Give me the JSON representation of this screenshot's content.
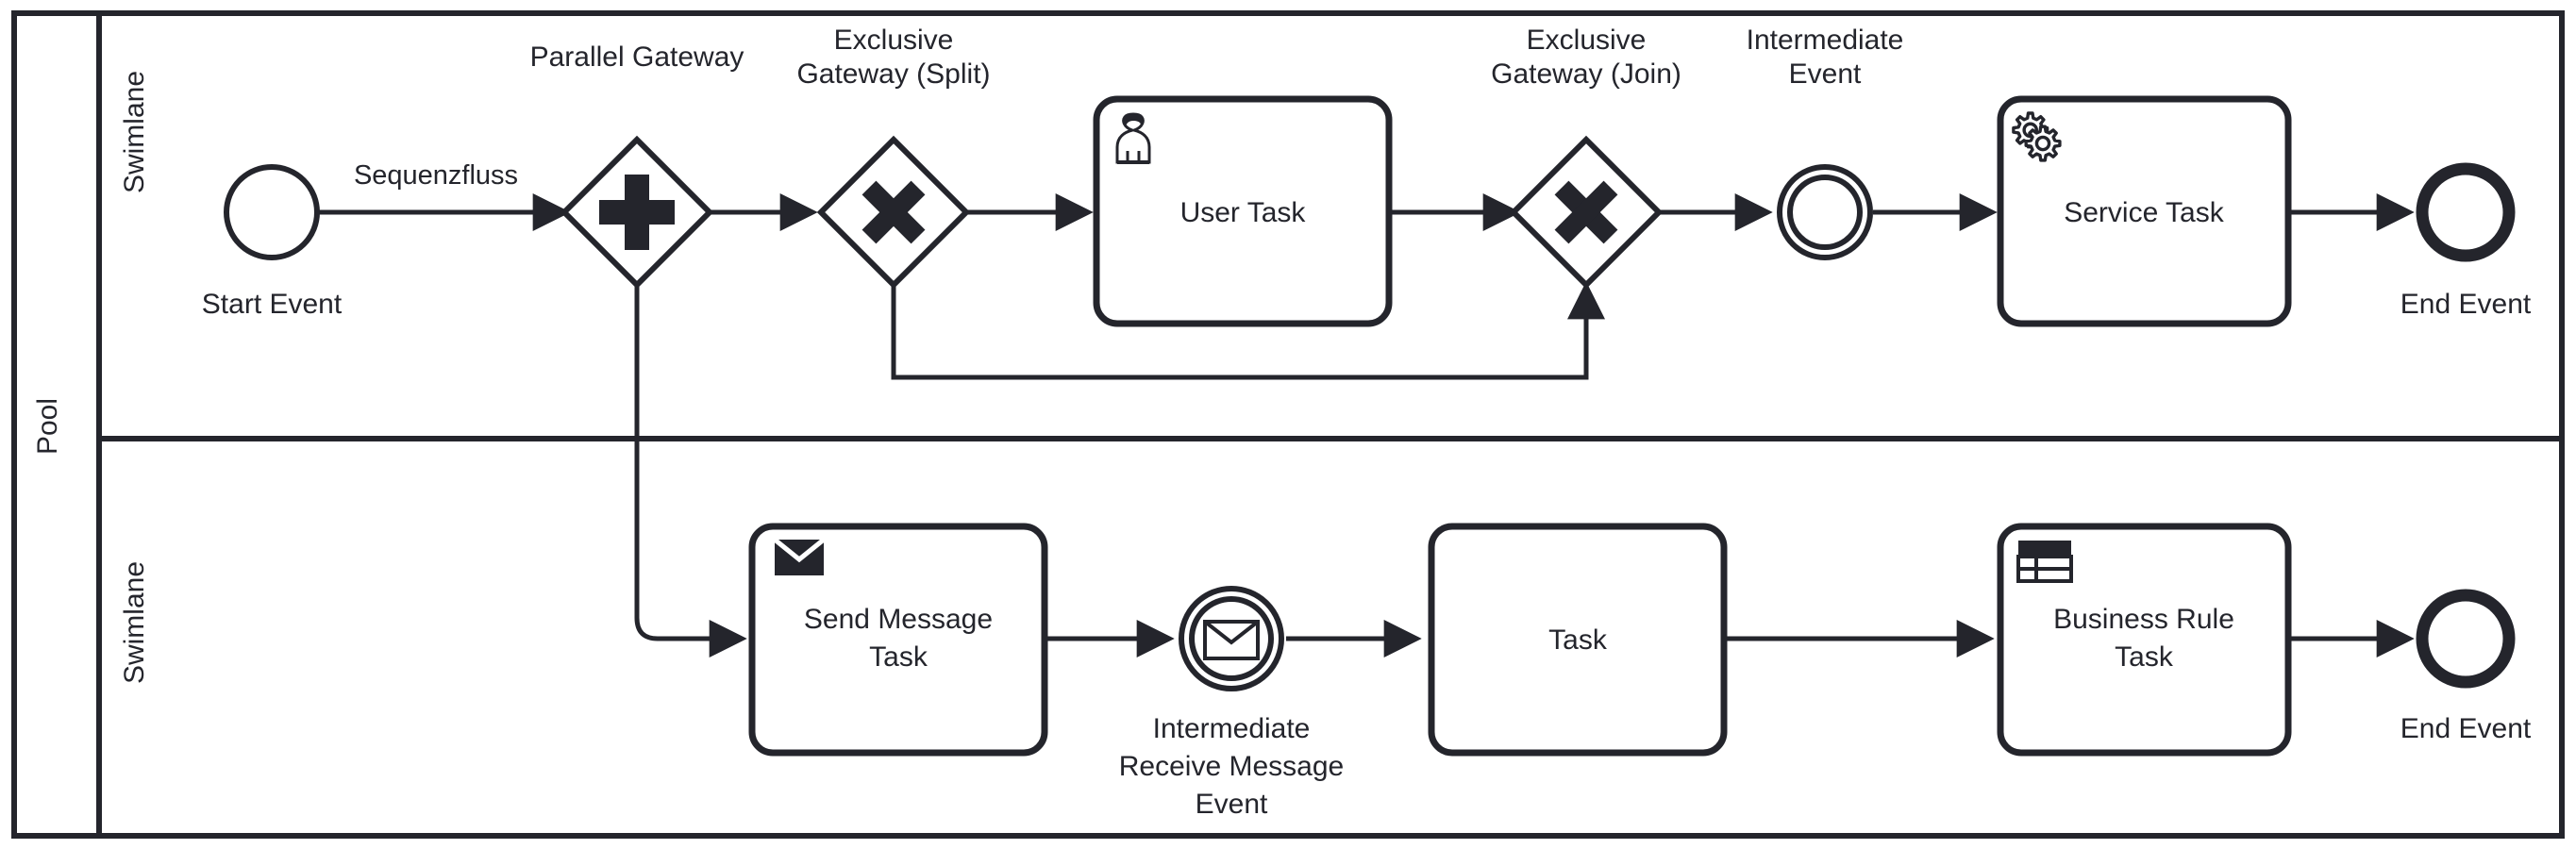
{
  "diagram": {
    "type": "BPMN process diagram",
    "pool": {
      "label": "Pool"
    },
    "lanes": [
      {
        "id": "lane-top",
        "label": "Swimlane"
      },
      {
        "id": "lane-bottom",
        "label": "Swimlane"
      }
    ],
    "colors": {
      "stroke": "#24252c",
      "fill": "#ffffff",
      "background": "#ffffff"
    },
    "flow_labels": [
      {
        "id": "sequence-flow-label",
        "text": "Sequenzfluss"
      }
    ],
    "nodes_top": [
      {
        "id": "start-event",
        "type": "start-event",
        "label": "Start Event",
        "label_position": "below"
      },
      {
        "id": "parallel-gateway",
        "type": "parallel-gateway",
        "label": "Parallel Gateway",
        "label_position": "above",
        "marker": "plus"
      },
      {
        "id": "exclusive-gateway-split",
        "type": "exclusive-gateway",
        "label_line1": "Exclusive",
        "label_line2": "Gateway (Split)",
        "label_position": "above",
        "marker": "x"
      },
      {
        "id": "user-task",
        "type": "task",
        "label": "User Task",
        "icon": "user-icon"
      },
      {
        "id": "exclusive-gateway-join",
        "type": "exclusive-gateway",
        "label_line1": "Exclusive",
        "label_line2": "Gateway (Join)",
        "label_position": "above",
        "marker": "x"
      },
      {
        "id": "intermediate-event",
        "type": "intermediate-event",
        "label_line1": "Intermediate",
        "label_line2": "Event",
        "label_position": "above"
      },
      {
        "id": "service-task",
        "type": "task",
        "label": "Service Task",
        "icon": "gear-icon"
      },
      {
        "id": "end-event-top",
        "type": "end-event",
        "label": "End Event",
        "label_position": "below"
      }
    ],
    "nodes_bottom": [
      {
        "id": "send-message-task",
        "type": "task",
        "label_line1": "Send Message",
        "label_line2": "Task",
        "icon": "envelope-filled-icon"
      },
      {
        "id": "intermediate-receive-message-event",
        "type": "intermediate-message-event",
        "label_line1": "Intermediate",
        "label_line2": "Receive Message",
        "label_line3": "Event",
        "label_position": "below",
        "icon": "envelope-outline-icon"
      },
      {
        "id": "plain-task",
        "type": "task",
        "label": "Task"
      },
      {
        "id": "business-rule-task",
        "type": "task",
        "label_line1": "Business Rule",
        "label_line2": "Task",
        "icon": "table-icon"
      },
      {
        "id": "end-event-bottom",
        "type": "end-event",
        "label": "End Event",
        "label_position": "below"
      }
    ]
  }
}
